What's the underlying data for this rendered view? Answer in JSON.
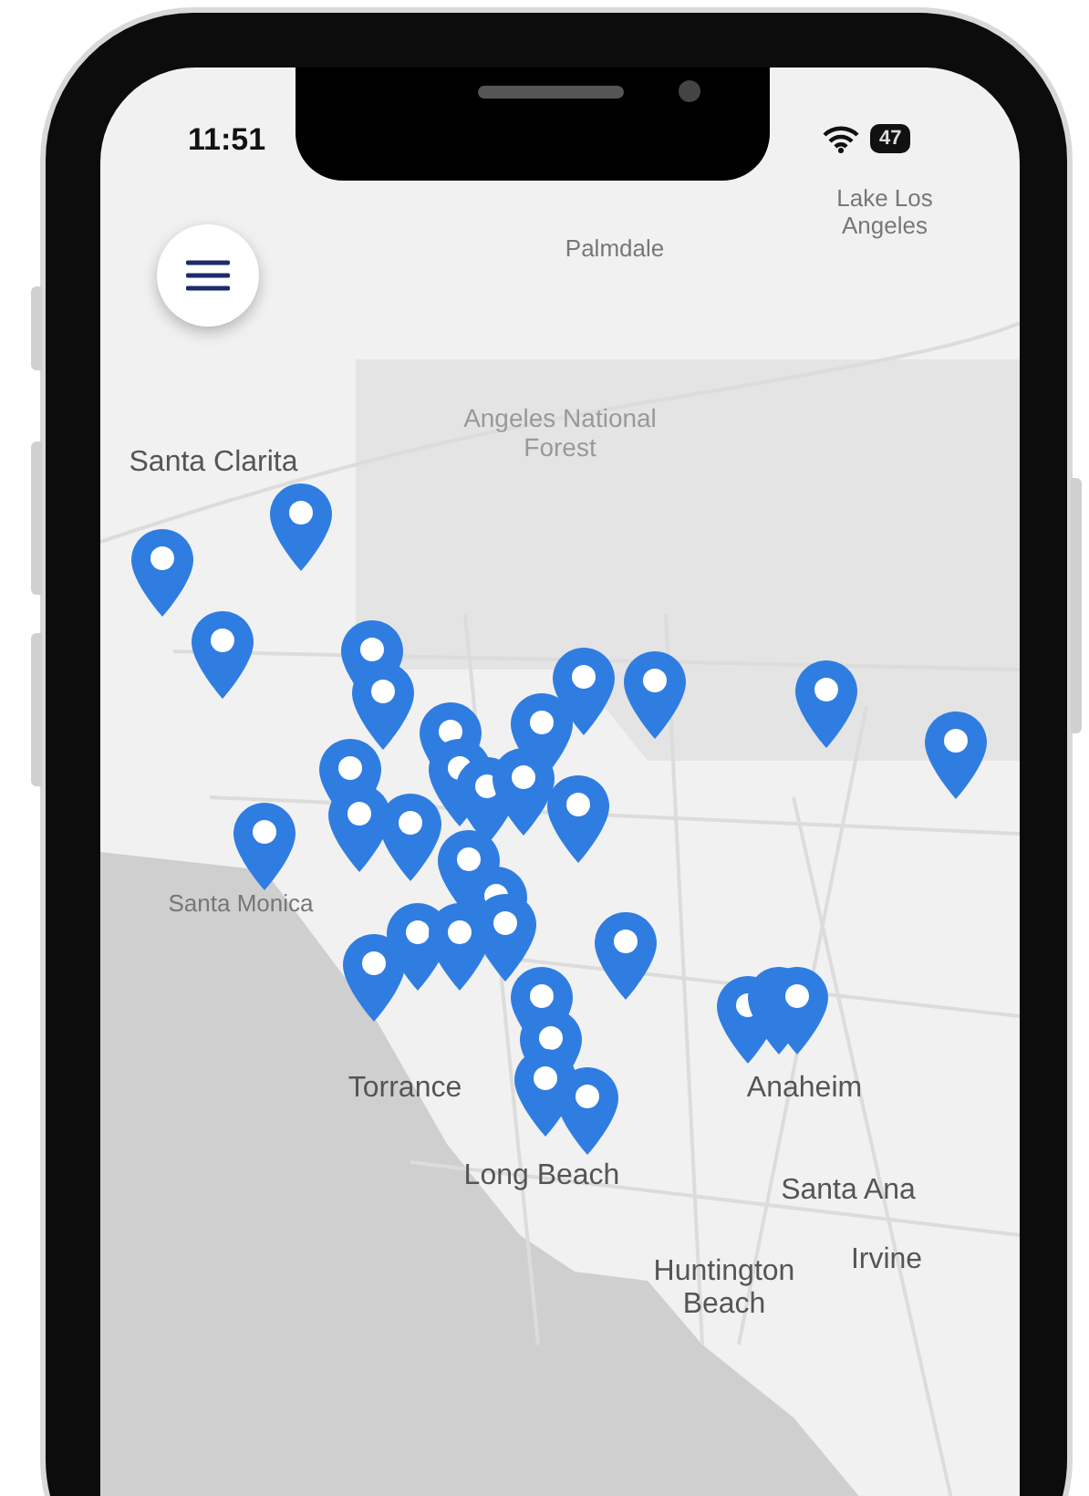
{
  "status_bar": {
    "time": "11:51",
    "battery": "47"
  },
  "map": {
    "labels": [
      {
        "text": "Lake Los Angeles",
        "kind": "small"
      },
      {
        "text": "Palmdale",
        "kind": "small"
      },
      {
        "text": "Santa Clarita",
        "kind": "city"
      },
      {
        "text": "Angeles National Forest",
        "kind": "park"
      },
      {
        "text": "Santa Monica",
        "kind": "small"
      },
      {
        "text": "Torrance",
        "kind": "city"
      },
      {
        "text": "Long Beach",
        "kind": "city"
      },
      {
        "text": "Anaheim",
        "kind": "city"
      },
      {
        "text": "Santa Ana",
        "kind": "city"
      },
      {
        "text": "Irvine",
        "kind": "city"
      },
      {
        "text": "Huntington Beach",
        "kind": "city"
      }
    ]
  }
}
